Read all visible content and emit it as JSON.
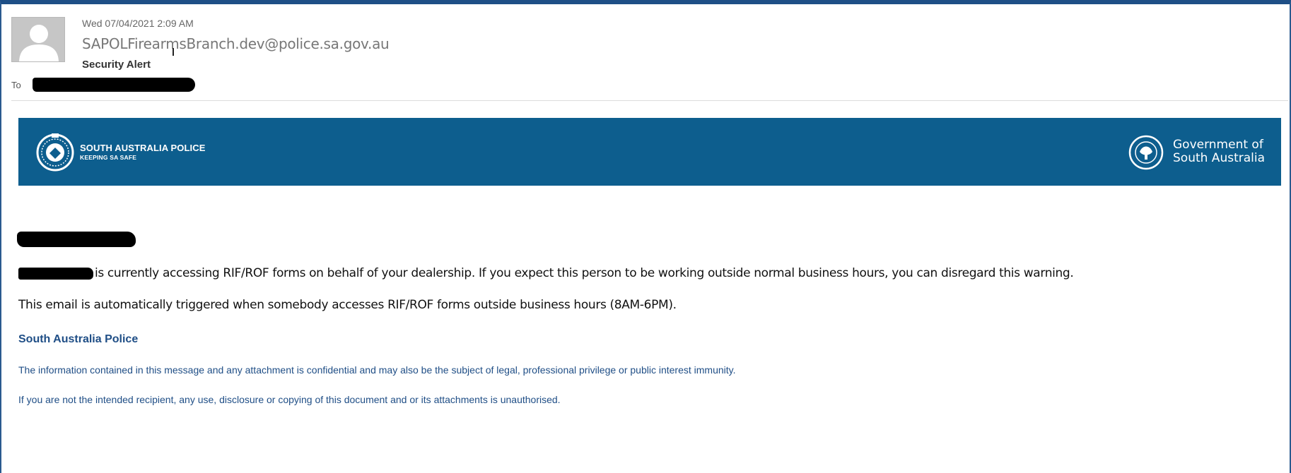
{
  "header": {
    "date": "Wed 07/04/2021 2:09 AM",
    "from": "SAPOLFirearmsBranch.dev@police.sa.gov.au",
    "subject": "Security Alert",
    "to_label": "To"
  },
  "banner": {
    "agency_name": "SOUTH AUSTRALIA POLICE",
    "agency_tagline": "KEEPING SA SAFE",
    "government_name_line1": "Government of",
    "government_name_line2": "South Australia",
    "color": "#0d5e8e"
  },
  "body": {
    "line1_after_redaction": "is currently accessing RIF/ROF forms on behalf of your dealership. If you expect this person to be working outside normal business hours, you can disregard this warning.",
    "line2": "This email is automatically triggered when somebody accesses RIF/ROF forms outside business hours (8AM-6PM)."
  },
  "signature": {
    "title": "South Australia Police",
    "disclaimer1": "The information contained in this message and any attachment is confidential and may also be the subject of legal, professional privilege or public interest immunity.",
    "disclaimer2": "If you are not the intended recipient, any use, disclosure or copying of this document and or its attachments is unauthorised.",
    "color": "#1f4e86"
  },
  "icons": {
    "sender_avatar": "person-silhouette-icon",
    "agency_logo": "police-badge-icon",
    "government_logo": "state-badge-icon"
  }
}
